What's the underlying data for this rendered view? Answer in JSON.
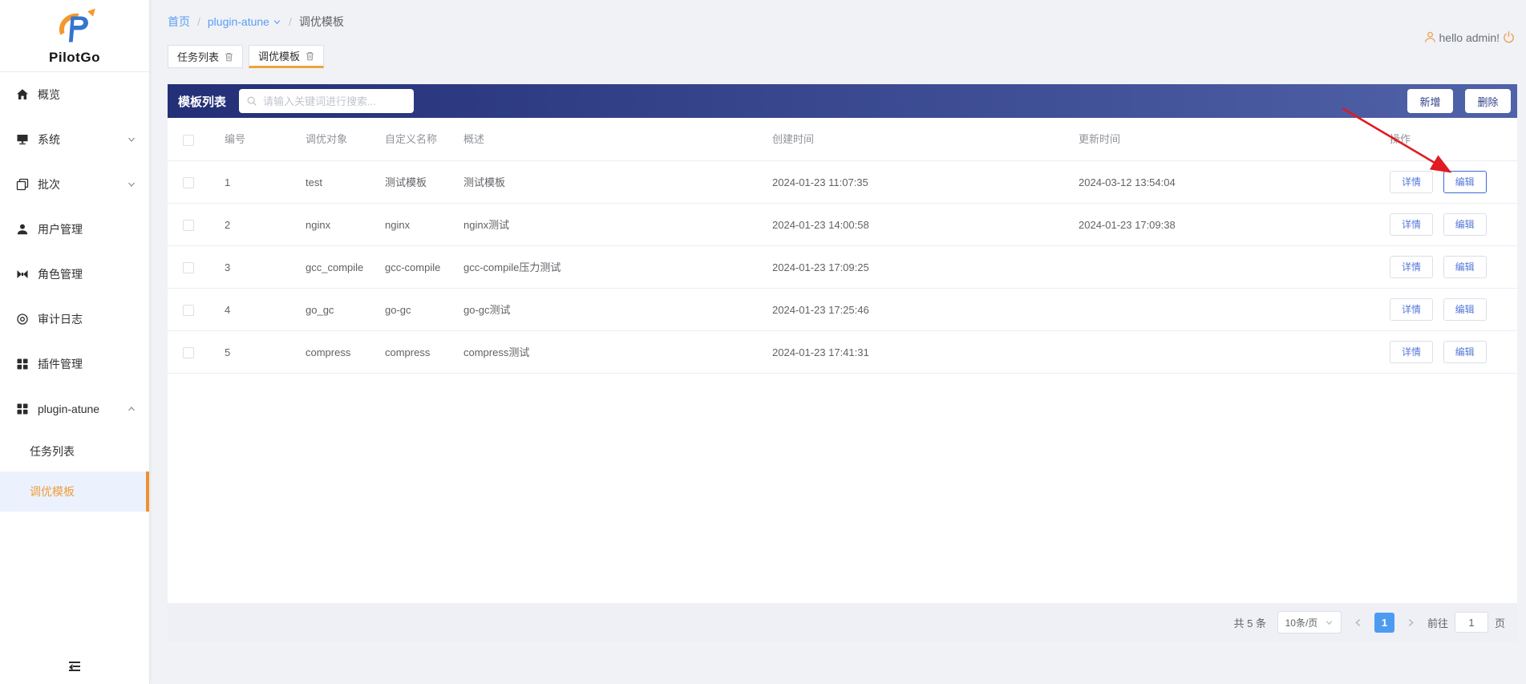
{
  "app": {
    "name": "PilotGo"
  },
  "topbar": {
    "breadcrumb": [
      {
        "label": "首页"
      },
      {
        "label": "plugin-atune"
      },
      {
        "label": "调优模板"
      }
    ],
    "user_greeting": "hello admin!"
  },
  "tabs": [
    {
      "label": "任务列表"
    },
    {
      "label": "调优模板",
      "active": true
    }
  ],
  "sidebar": {
    "items": [
      {
        "label": "概览",
        "icon": "home-icon"
      },
      {
        "label": "系统",
        "icon": "monitor-icon",
        "chevron": "down"
      },
      {
        "label": "批次",
        "icon": "batch-icon",
        "chevron": "down"
      },
      {
        "label": "用户管理",
        "icon": "user-icon"
      },
      {
        "label": "角色管理",
        "icon": "roles-icon"
      },
      {
        "label": "审计日志",
        "icon": "audit-eye-icon"
      },
      {
        "label": "插件管理",
        "icon": "plugins-grid-icon"
      },
      {
        "label": "plugin-atune",
        "icon": "plugin-grid-icon",
        "chevron": "up"
      }
    ],
    "submenu": [
      {
        "label": "任务列表"
      },
      {
        "label": "调优模板",
        "selected": true
      }
    ]
  },
  "panel": {
    "title": "模板列表",
    "search_placeholder": "请输入关键词进行搜索...",
    "add_label": "新增",
    "delete_label": "删除"
  },
  "table": {
    "headers": [
      "编号",
      "调优对象",
      "自定义名称",
      "概述",
      "创建时间",
      "更新时间",
      "操作"
    ],
    "action_labels": {
      "detail": "详情",
      "edit": "编辑"
    },
    "rows": [
      {
        "id": "1",
        "target": "test",
        "name": "测试模板",
        "summary": "测试模板",
        "created": "2024-01-23 11:07:35",
        "updated": "2024-03-12 13:54:04"
      },
      {
        "id": "2",
        "target": "nginx",
        "name": "nginx",
        "summary": "nginx测试",
        "created": "2024-01-23 14:00:58",
        "updated": "2024-01-23 17:09:38"
      },
      {
        "id": "3",
        "target": "gcc_compile",
        "name": "gcc-compile",
        "summary": "gcc-compile压力测试",
        "created": "2024-01-23 17:09:25",
        "updated": ""
      },
      {
        "id": "4",
        "target": "go_gc",
        "name": "go-gc",
        "summary": "go-gc测试",
        "created": "2024-01-23 17:25:46",
        "updated": ""
      },
      {
        "id": "5",
        "target": "compress",
        "name": "compress",
        "summary": "compress测试",
        "created": "2024-01-23 17:41:31",
        "updated": ""
      }
    ]
  },
  "pagination": {
    "total_text": "共 5 条",
    "page_size": "10条/页",
    "current_page": "1",
    "goto_label": "前往",
    "goto_value": "1",
    "page_unit": "页"
  },
  "annotation": {
    "type": "red-arrow",
    "color": "#e11b22",
    "points_to": "row-1 编辑 button"
  },
  "colors": {
    "accent_orange": "#f0a33b",
    "header_gradient_start": "#232f77",
    "header_gradient_end": "#5062a8",
    "link_blue": "#5d9df6",
    "action_blue": "#5677d9",
    "active_page_blue": "#4d9bf1",
    "arrow_red": "#e11b22"
  }
}
